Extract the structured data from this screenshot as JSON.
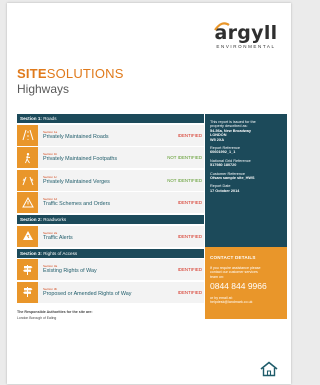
{
  "logo": {
    "word": "argyll",
    "subtitle": "ENVIRONMENTAL"
  },
  "title": {
    "part1_bold": "SITE",
    "part1_rest": "SOLUTIONS",
    "part2": "Highways"
  },
  "sections": [
    {
      "prefix": "Section 1:",
      "name": "Roads",
      "items": [
        {
          "label": "Section 1a",
          "title": "Privately Maintained Roads",
          "status": "IDENTIFIED",
          "icon": "road-icon"
        },
        {
          "label": "Section 1b",
          "title": "Privately Maintained Footpaths",
          "status": "NOT IDENTIFIED",
          "icon": "footpath-icon"
        },
        {
          "label": "Section 1c",
          "title": "Privately Maintained Verges",
          "status": "NOT IDENTIFIED",
          "icon": "verge-icon"
        },
        {
          "label": "Section 1d",
          "title": "Traffic Schemes and Orders",
          "status": "IDENTIFIED",
          "icon": "traffic-scheme-icon"
        }
      ]
    },
    {
      "prefix": "Section 2:",
      "name": "Roadworks",
      "items": [
        {
          "label": "Section 2a",
          "title": "Traffic Alerts",
          "status": "IDENTIFIED",
          "icon": "roadworks-icon"
        }
      ]
    },
    {
      "prefix": "Section 3:",
      "name": "Rights of Access",
      "items": [
        {
          "label": "Section 3a",
          "title": "Existing Rights of Way",
          "status": "IDENTIFIED",
          "icon": "signpost-icon"
        },
        {
          "label": "Section 3b",
          "title": "Proposed or Amended Rights of Way",
          "status": "IDENTIFIED",
          "icon": "signpost-icon"
        }
      ]
    }
  ],
  "authority": {
    "title": "The Responsible Authorities for the site are:",
    "value": "London Borough of Ealing"
  },
  "side_info": {
    "issued_line1": "This report is issued for the",
    "issued_line2": "property described as:",
    "address1": "54-56a, New Broadway",
    "address2": "LONDON",
    "address3": "W5 2XA",
    "report_ref_label": "Report Reference",
    "report_ref_value": "60601992_1_1",
    "grid_ref_label": "National Grid Reference",
    "grid_ref_value": "517980 180720",
    "customer_ref_label": "Customer Reference",
    "customer_ref_value": "Ofsam sample site_HWS",
    "report_date_label": "Report Date",
    "report_date_value": "17 October 2014"
  },
  "contact": {
    "title": "CONTACT DETAILS",
    "line1": "If you require assistance please",
    "line2": "contact our customer services",
    "line3": "team on:",
    "phone": "0844 844 9966",
    "email_line1": "or by email at:",
    "email_line2": "helpdesk@landmark.co.uk"
  },
  "colors": {
    "navy": "#1c4a5a",
    "orange": "#e9962a",
    "title_orange": "#e07a1b",
    "identified": "#d42a1a",
    "not_identified": "#5c9a2a"
  }
}
